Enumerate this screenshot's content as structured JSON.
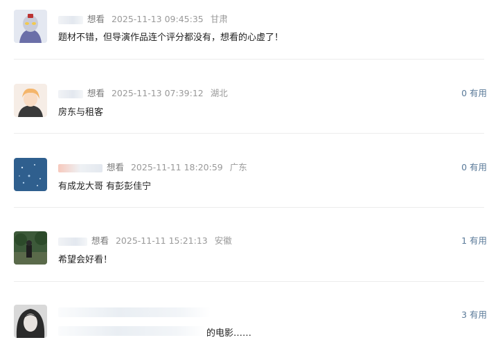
{
  "comments": [
    {
      "action": "想看",
      "time": "2025-11-13 09:45:35",
      "location": "甘肃",
      "content": "题材不错，但导演作品连个评分都没有，想看的心虚了！",
      "useful": ""
    },
    {
      "action": "想看",
      "time": "2025-11-13 07:39:12",
      "location": "湖北",
      "content": "房东与租客",
      "useful": "0 有用"
    },
    {
      "action": "想看",
      "time": "2025-11-11 18:20:59",
      "location": "广东",
      "content": "有成龙大哥 有彭彭佳宁",
      "useful": "0 有用"
    },
    {
      "action": "想看",
      "time": "2025-11-11 15:21:13",
      "location": "安徽",
      "content": "希望会好看！",
      "useful": "1 有用"
    },
    {
      "action": "",
      "time": "",
      "location": "",
      "content": "的电影……",
      "useful": "3 有用"
    }
  ]
}
